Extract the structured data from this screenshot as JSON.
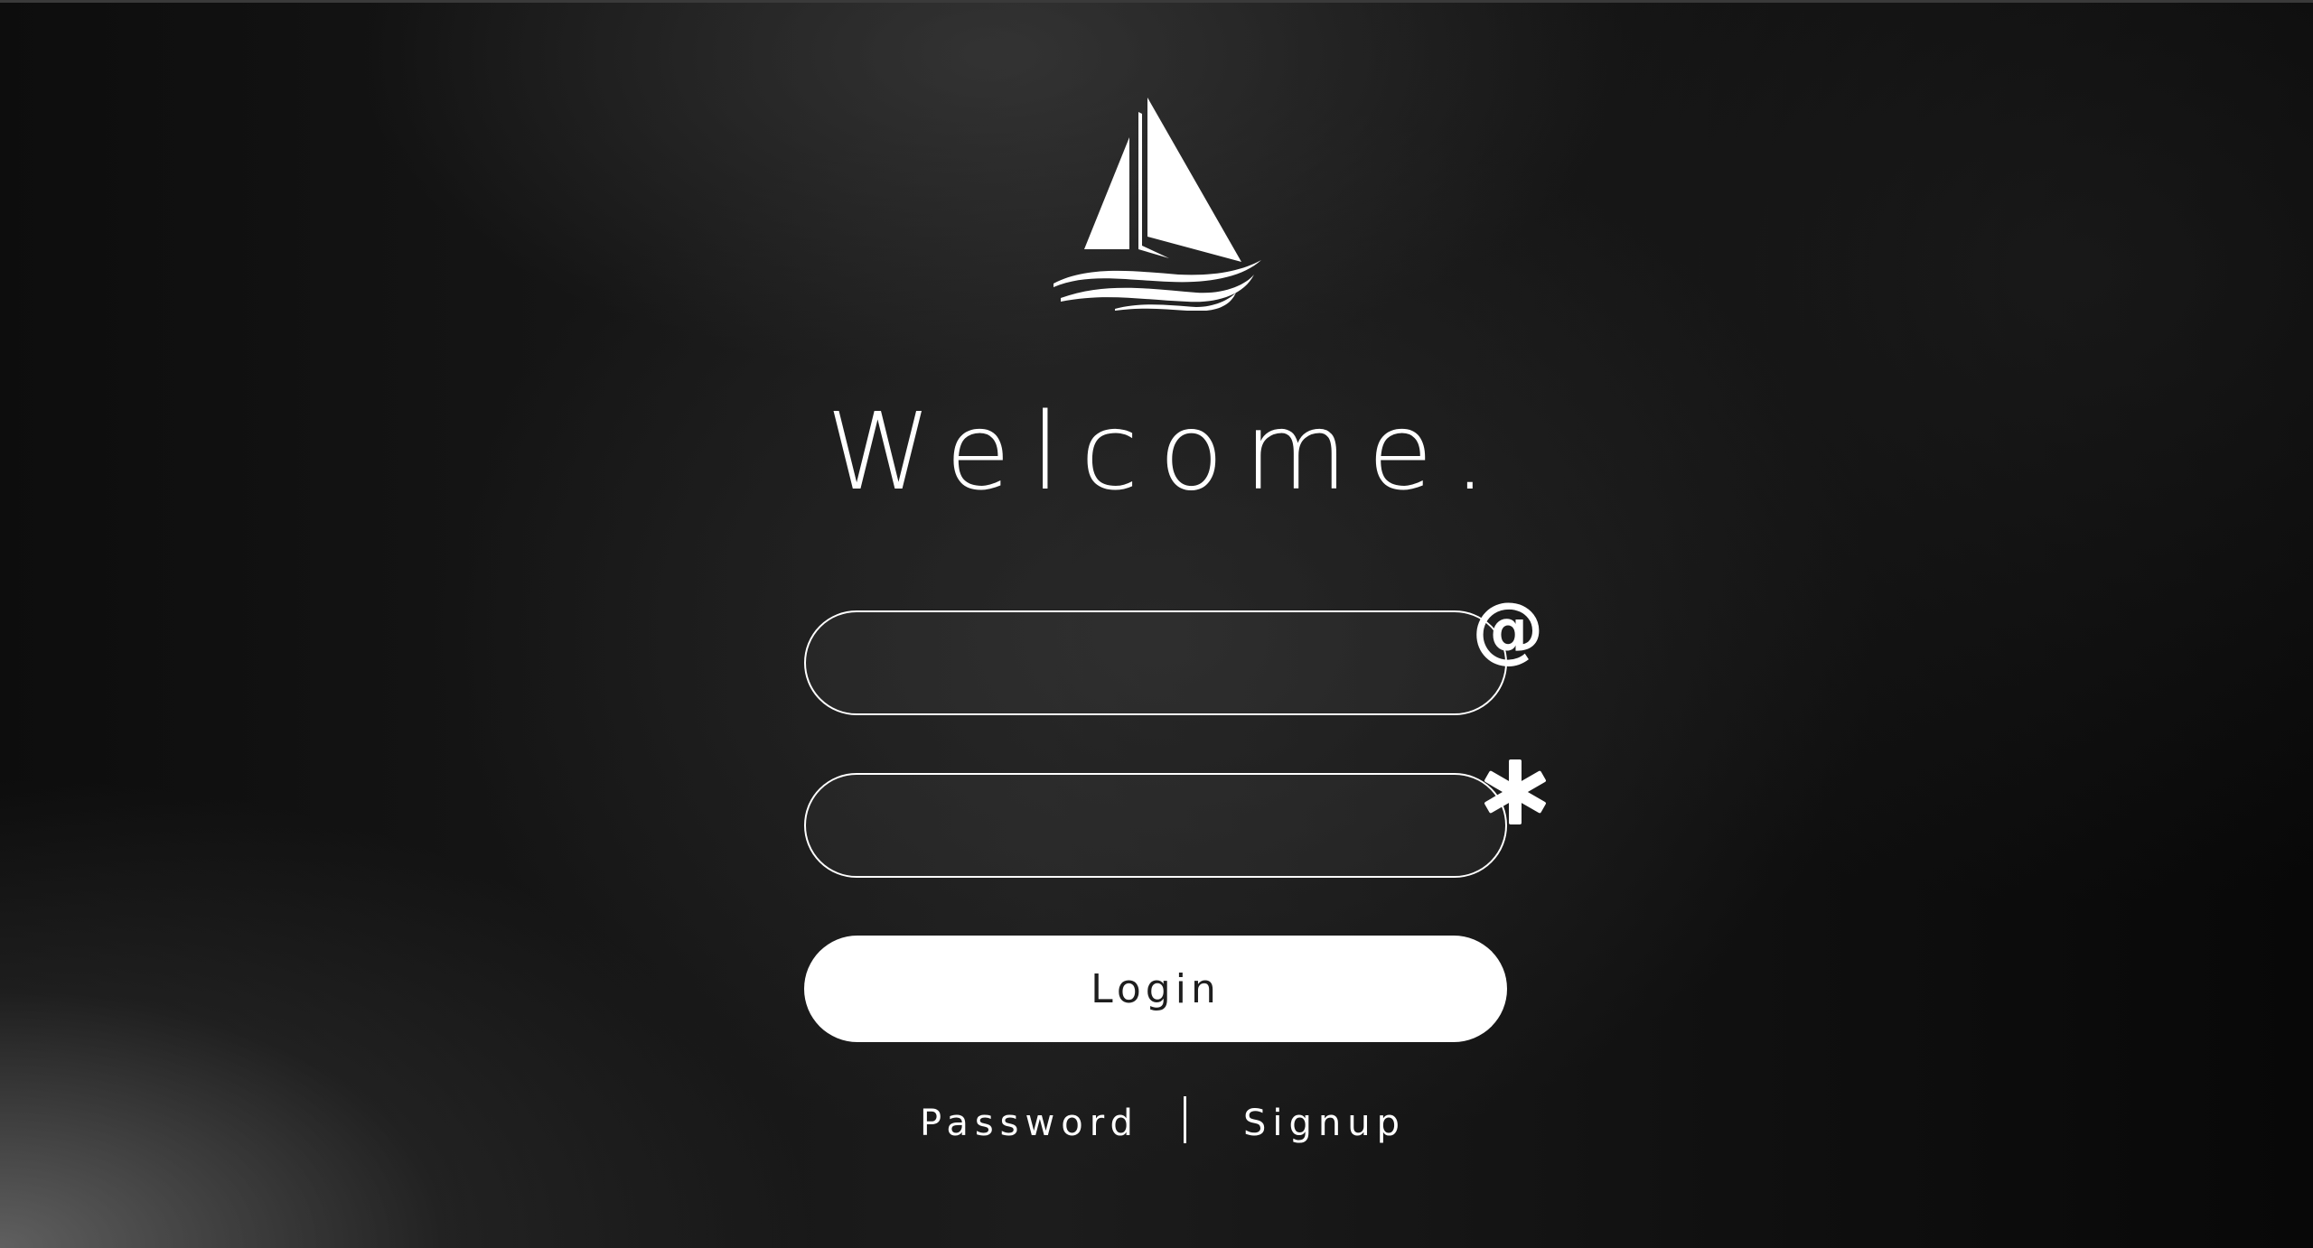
{
  "page": {
    "heading": "Welcome."
  },
  "form": {
    "email": {
      "value": "",
      "placeholder": "",
      "icon": "at-icon",
      "icon_glyph": "@"
    },
    "password": {
      "value": "",
      "placeholder": "",
      "icon": "asterisk-icon"
    },
    "login_label": "Login"
  },
  "links": {
    "password": "Password",
    "signup": "Signup"
  },
  "logo": {
    "icon": "sailboat-logo-icon"
  },
  "colors": {
    "accent": "#ffffff",
    "background": "#121212",
    "button_text": "#1e1e1e"
  }
}
